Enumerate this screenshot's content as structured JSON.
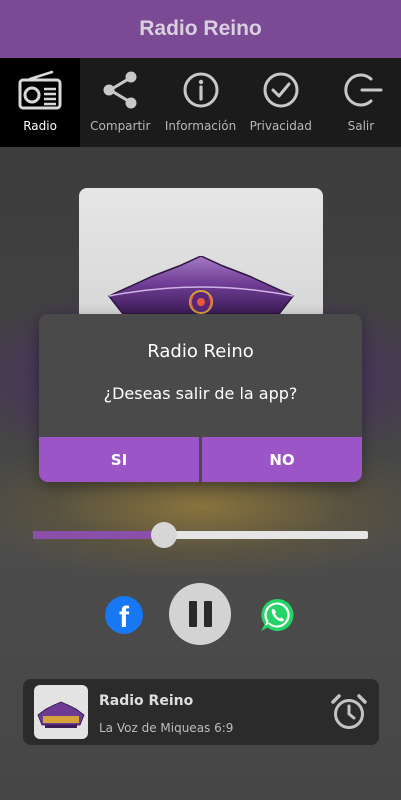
{
  "app": {
    "title": "Radio Reino"
  },
  "nav": {
    "items": [
      {
        "label": "Radio",
        "icon": "radio-icon",
        "active": true
      },
      {
        "label": "Compartir",
        "icon": "share-icon",
        "active": false
      },
      {
        "label": "Información",
        "icon": "info-icon",
        "active": false
      },
      {
        "label": "Privacidad",
        "icon": "check-circle-icon",
        "active": false
      },
      {
        "label": "Salir",
        "icon": "exit-icon",
        "active": false
      }
    ]
  },
  "player": {
    "progress": 0.39,
    "state": "playing"
  },
  "mini_player": {
    "station": "Radio Reino",
    "subtitle": "La Voz de Miqueas 6:9"
  },
  "dialog": {
    "title": "Radio Reino",
    "message": "¿Deseas salir de la app?",
    "yes_label": "SI",
    "no_label": "NO"
  },
  "colors": {
    "brand": "#7a4a94",
    "accent": "#9c55c7",
    "facebook": "#1877f2",
    "whatsapp": "#25d366"
  }
}
